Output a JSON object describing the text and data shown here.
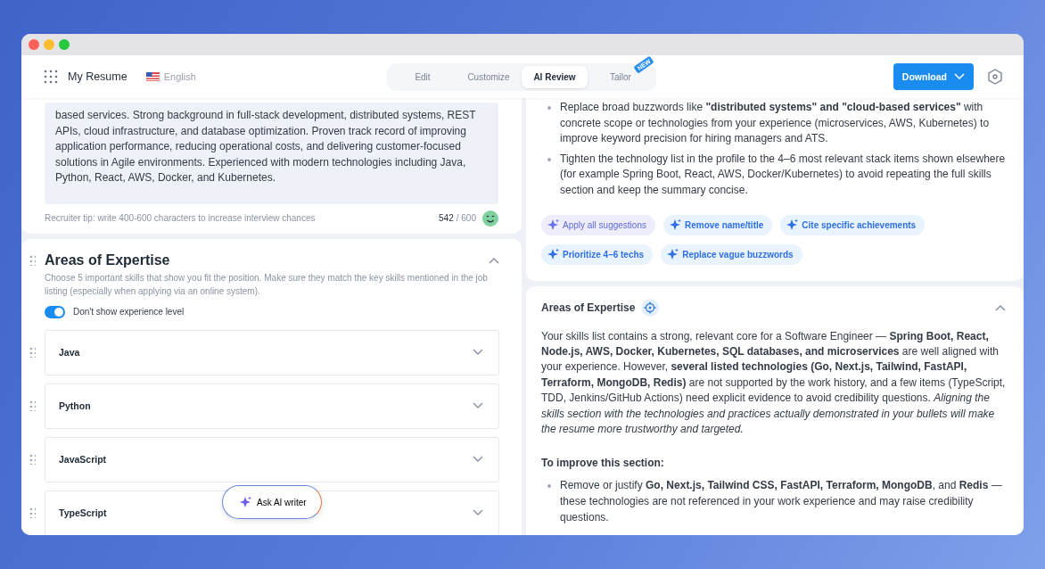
{
  "header": {
    "app_name": "My Resume",
    "language": "English",
    "tabs": [
      {
        "label": "Edit",
        "selected": false
      },
      {
        "label": "Customize",
        "selected": false
      },
      {
        "label": "AI Review",
        "selected": true
      },
      {
        "label": "Tailor",
        "selected": false,
        "badge": "NEW"
      }
    ],
    "download_button": "Download"
  },
  "summary": {
    "text": "based services. Strong background in full-stack development, distributed systems, REST APIs, cloud infrastructure, and database optimization. Proven track record of improving application performance, reducing operational costs, and delivering customer-focused solutions in Agile environments. Experienced with modern technologies including Java, Python, React, AWS, Docker, and Kubernetes.",
    "tip": "Recruiter tip: write 400-600 characters to increase interview chances",
    "count": "542",
    "limit": "/ 600"
  },
  "expertise": {
    "title": "Areas of Expertise",
    "expanded": true,
    "description": "Choose 5 important skills that show you fit the position. Make sure they match the key skills mentioned in the job listing (especially when applying via an online system).",
    "toggle": {
      "label": "Don't show experience level",
      "on": true
    },
    "skills": [
      {
        "name": "Java",
        "expanded": false
      },
      {
        "name": "Python",
        "expanded": false
      },
      {
        "name": "JavaScript",
        "expanded": false
      },
      {
        "name": "TypeScript",
        "expanded": false
      }
    ]
  },
  "ask_ai_button": "Ask AI writer",
  "review": {
    "bullets": [
      "Replace broad buzzwords like **\"distributed systems\" and \"cloud-based services\"** with concrete scope or technologies from your experience (microservices, AWS, Kubernetes) to improve keyword precision for hiring managers and ATS.",
      "Tighten the technology list in the profile to the 4–6 most relevant stack items shown elsewhere (for example Spring Boot, React, AWS, Docker/Kubernetes) to avoid repeating the full skills section and keep the summary concise."
    ],
    "suggestions": [
      {
        "label": "Apply all suggestions",
        "kind": "all"
      },
      {
        "label": "Remove name/title",
        "kind": "fix"
      },
      {
        "label": "Cite specific achievements",
        "kind": "fix"
      },
      {
        "label": "Prioritize 4–6 techs",
        "kind": "fix"
      },
      {
        "label": "Replace vague buzzwords",
        "kind": "fix"
      }
    ]
  },
  "expertise_review": {
    "title": "Areas of Expertise",
    "expanded": true,
    "paragraph": "Your skills list contains a strong, relevant core for a Software Engineer — **Spring Boot, React, Node.js, AWS, Docker, Kubernetes, SQL databases, and microservices** are well aligned with your experience. However, **several listed technologies (Go, Next.js, Tailwind, FastAPI, Terraform, MongoDB, Redis)** are not supported by the work history, and a few items (TypeScript, TDD, Jenkins/GitHub Actions) need explicit evidence to avoid credibility questions. *Aligning the skills section with the technologies and practices actually demonstrated in your bullets will make the resume more trustworthy and targeted.*",
    "improve_heading": "To improve this section:",
    "bullets": [
      "Remove or justify **Go, Next.js, Tailwind CSS, FastAPI, Terraform, MongoDB**, and **Redis** — these technologies are not referenced in your work experience and may raise credibility questions."
    ]
  }
}
